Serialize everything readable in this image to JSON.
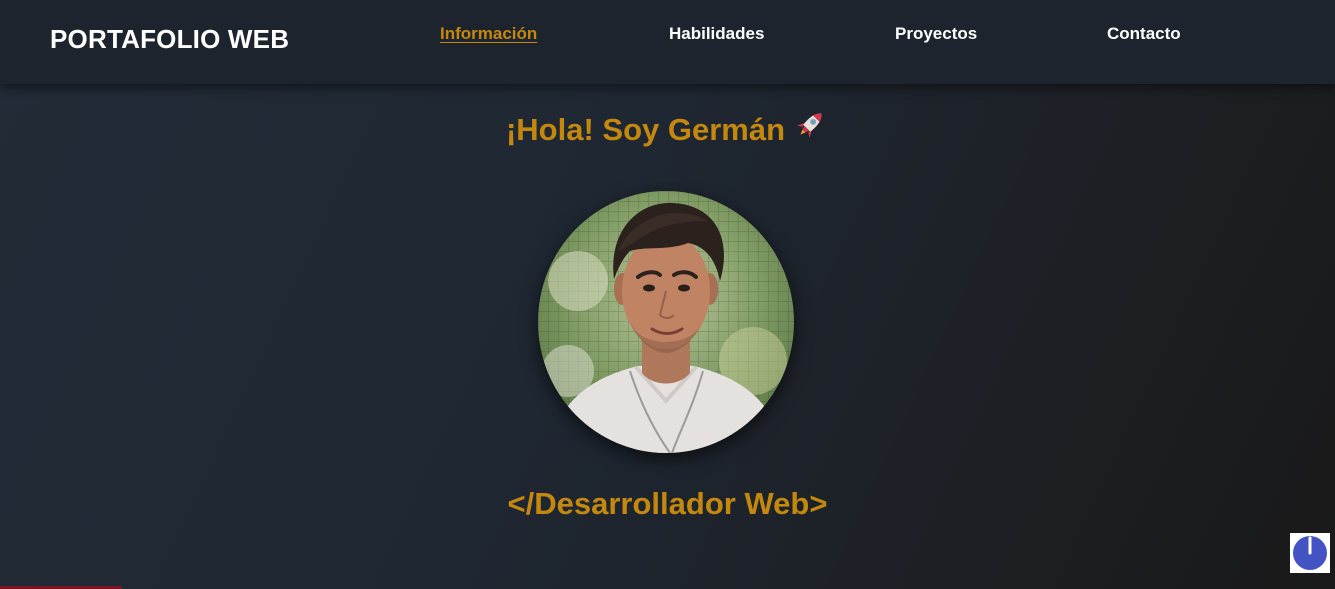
{
  "header": {
    "brand": "PORTAFOLIO WEB",
    "nav": [
      {
        "label": "Información",
        "active": true
      },
      {
        "label": "Habilidades",
        "active": false
      },
      {
        "label": "Proyectos",
        "active": false
      },
      {
        "label": "Contacto",
        "active": false
      }
    ]
  },
  "hero": {
    "greeting": "¡Hola! Soy Germán",
    "greeting_icon": "rocket-icon",
    "avatar": "profile-photo",
    "role": "</Desarrollador Web>"
  },
  "widget": {
    "icon": "power-icon"
  },
  "colors": {
    "accent": "#c4880f",
    "navbar": "#1d242d",
    "background": "#1f2732",
    "widget_icon": "#4353c4"
  }
}
